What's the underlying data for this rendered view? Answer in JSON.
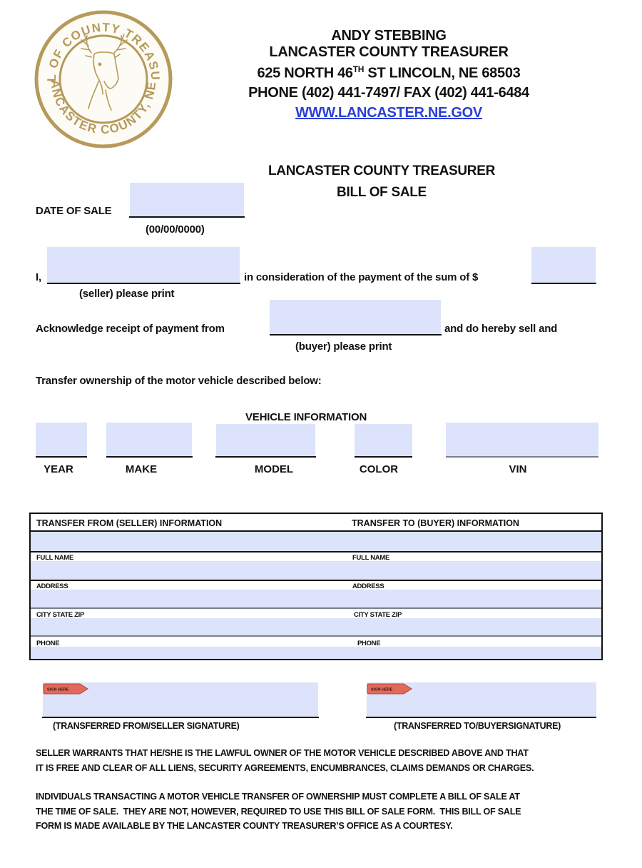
{
  "seal": {
    "top_text": "SEAL OF COUNTY TREASURER",
    "bottom_text": "LANCASTER COUNTY, NEB",
    "color": "#b59a5a"
  },
  "header": {
    "name": "ANDY STEBBING",
    "office": "LANCASTER COUNTY TREASURER",
    "address_pre": "625 NORTH 46",
    "address_sup": "TH",
    "address_post": " ST LINCOLN, NE 68503",
    "phone_fax": "PHONE (402) 441-7497/ FAX (402) 441-6484",
    "website": "WWW.LANCASTER.NE.GOV"
  },
  "form_title": {
    "line1": "LANCASTER COUNTY TREASURER",
    "line2": "BILL OF SALE"
  },
  "date_of_sale": {
    "label": "DATE OF SALE",
    "value": "",
    "format_hint": "(00/00/0000)"
  },
  "seller_statement": {
    "prefix": "I,",
    "seller_value": "",
    "seller_hint": "(seller) please print",
    "middle": "in consideration of the payment of the sum of $",
    "amount_value": ""
  },
  "buyer_statement": {
    "prefix": "Acknowledge receipt of payment from",
    "buyer_value": "",
    "buyer_hint": "(buyer) please print",
    "suffix": "and do hereby sell and"
  },
  "transfer_statement": "Transfer ownership of the motor vehicle described below:",
  "vehicle": {
    "heading": "VEHICLE INFORMATION",
    "fields": [
      {
        "label": "YEAR",
        "value": ""
      },
      {
        "label": "MAKE",
        "value": ""
      },
      {
        "label": "MODEL",
        "value": ""
      },
      {
        "label": "COLOR",
        "value": ""
      },
      {
        "label": "VIN",
        "value": ""
      }
    ]
  },
  "transfer_table": {
    "seller_heading": "TRANSFER FROM (SELLER) INFORMATION",
    "buyer_heading": "TRANSFER TO (BUYER) INFORMATION",
    "rows": [
      "FULL NAME",
      "ADDRESS",
      "CITY STATE ZIP",
      "PHONE"
    ]
  },
  "signatures": {
    "tag_label": "SIGN HERE",
    "tag_color": "#e06a5a",
    "seller_caption": "(TRANSFERRED FROM/SELLER SIGNATURE)",
    "buyer_caption": "(TRANSFERRED TO/BUYERSIGNATURE)"
  },
  "disclaimers": {
    "warranty_line1": "SELLER WARRANTS THAT HE/SHE IS THE LAWFUL OWNER OF THE MOTOR VEHICLE DESCRIBED ABOVE AND THAT",
    "warranty_line2": "IT IS FREE AND CLEAR OF ALL LIENS, SECURITY AGREEMENTS, ENCUMBRANCES, CLAIMS DEMANDS OR CHARGES.",
    "notice_line1": "INDIVIDUALS TRANSACTING A MOTOR VEHICLE TRANSFER OF OWNERSHIP MUST COMPLETE A BILL OF SALE AT",
    "notice_line2": "THE TIME OF SALE.  THEY ARE NOT, HOWEVER, REQUIRED TO USE THIS BILL OF SALE FORM.  THIS BILL OF SALE",
    "notice_line3": "FORM IS MADE AVAILABLE BY THE LANCASTER COUNTY TREASURER’S OFFICE AS A COURTESY."
  }
}
